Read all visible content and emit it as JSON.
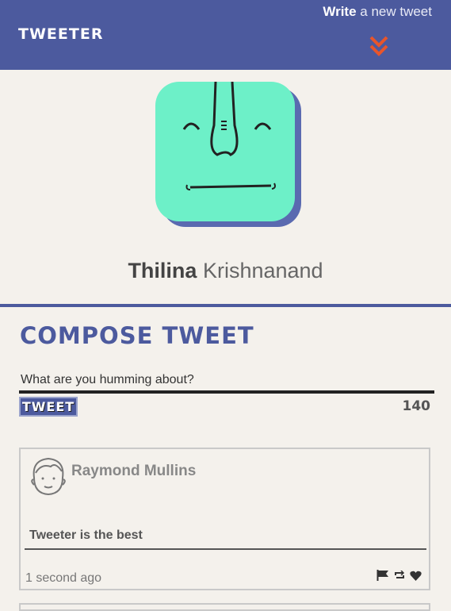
{
  "nav": {
    "brand": "Tweeter",
    "write_bold": "Write",
    "write_rest": " a new tweet",
    "chevron_icon": "double-chevron-down-icon",
    "chevron_color": "#e8552b"
  },
  "profile": {
    "avatar_icon": "smiling-face-avatar",
    "avatar_color": "#6df0c8",
    "first_name": "Thilina",
    "last_name": " Krishnanand"
  },
  "compose": {
    "title": "Compose Tweet",
    "placeholder": "What are you humming about?",
    "button_label": "Tweet",
    "counter": "140"
  },
  "tweets": [
    {
      "author": "Raymond Mullins",
      "avatar_icon": "face-outline-icon",
      "text": "Tweeter is the best",
      "time": "1 second ago",
      "actions": [
        "flag-icon",
        "retweet-icon",
        "heart-icon"
      ]
    }
  ],
  "colors": {
    "accent": "#4c5a9e",
    "background": "#f4f1ec"
  }
}
